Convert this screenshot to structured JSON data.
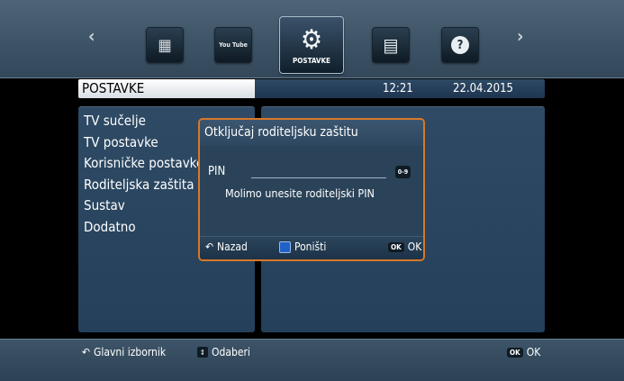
{
  "top_menu": {
    "left_arrow": "‹",
    "right_arrow": "›",
    "icons": [
      {
        "name": "epg-icon",
        "glyph": "▦"
      },
      {
        "name": "youtube-icon",
        "glyph": "You Tube"
      },
      {
        "name": "settings-gear-icon",
        "glyph": "⚙",
        "label": "POSTAVKE"
      },
      {
        "name": "clipboard-icon",
        "glyph": "▤"
      },
      {
        "name": "help-icon",
        "glyph": "?"
      }
    ]
  },
  "titlebar": {
    "title": "POSTAVKE",
    "time": "12:21",
    "date": "22.04.2015"
  },
  "settings_menu": [
    "TV sučelje",
    "TV postavke",
    "Korisničke postavke",
    "Roditeljska zaštita",
    "Sustav",
    "Dodatno"
  ],
  "dialog": {
    "title": "Otključaj roditeljsku zaštitu",
    "pin_label": "PIN",
    "pin_keys": "0-9",
    "prompt": "Molimo unesite roditeljski PIN",
    "back_label": "Nazad",
    "cancel_label": "Poništi",
    "ok_badge": "OK",
    "ok_label": "OK"
  },
  "bottombar": {
    "main_menu_label": "Glavni izbornik",
    "select_label": "Odaberi",
    "ok_badge": "OK",
    "ok_label": "OK"
  },
  "colors": {
    "dialog_border": "#d8782a",
    "panel_bg": "#2e4a64",
    "blue_button": "#1f62c7"
  }
}
